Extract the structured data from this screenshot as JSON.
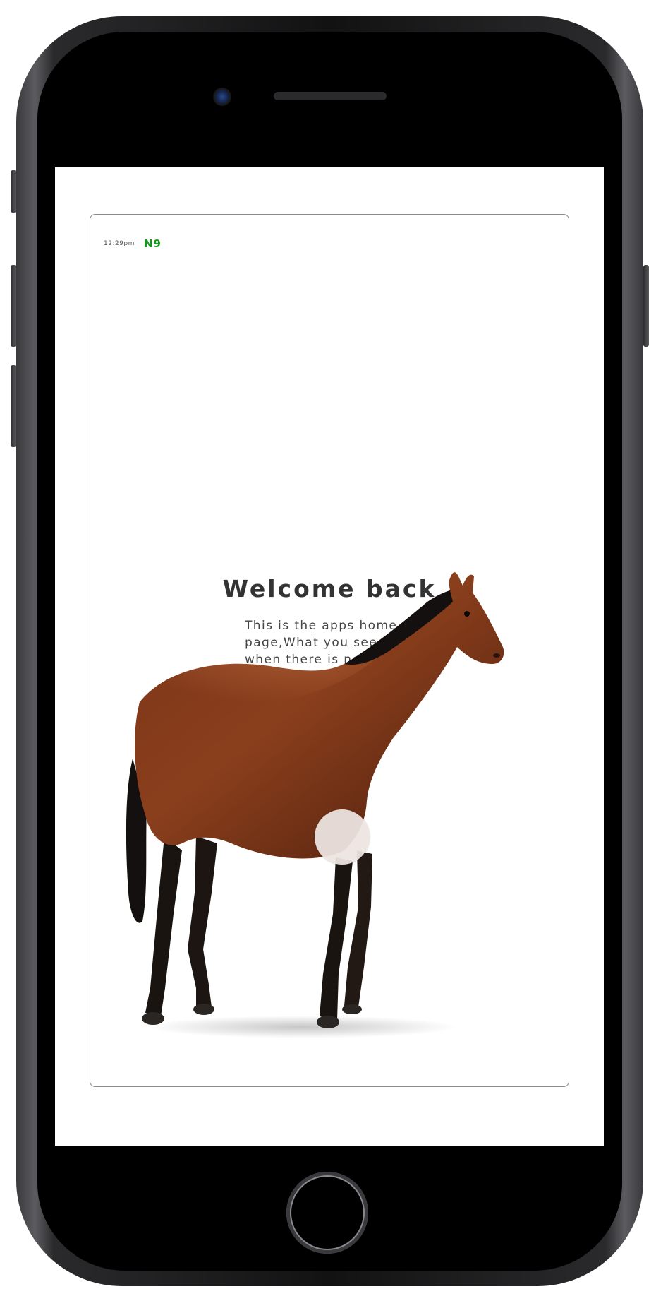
{
  "status_bar": {
    "time": "12:29pm",
    "carrier": "N9"
  },
  "home": {
    "title": "Welcome back",
    "description": "This is the apps home page,What you see when there is no problems",
    "hero_image": "horse-illustration"
  },
  "colors": {
    "carrier_green": "#119a1c",
    "title_text": "#333333",
    "body_text": "#444444",
    "frame_border": "#8a8a8a",
    "phone_body": "#121213"
  }
}
